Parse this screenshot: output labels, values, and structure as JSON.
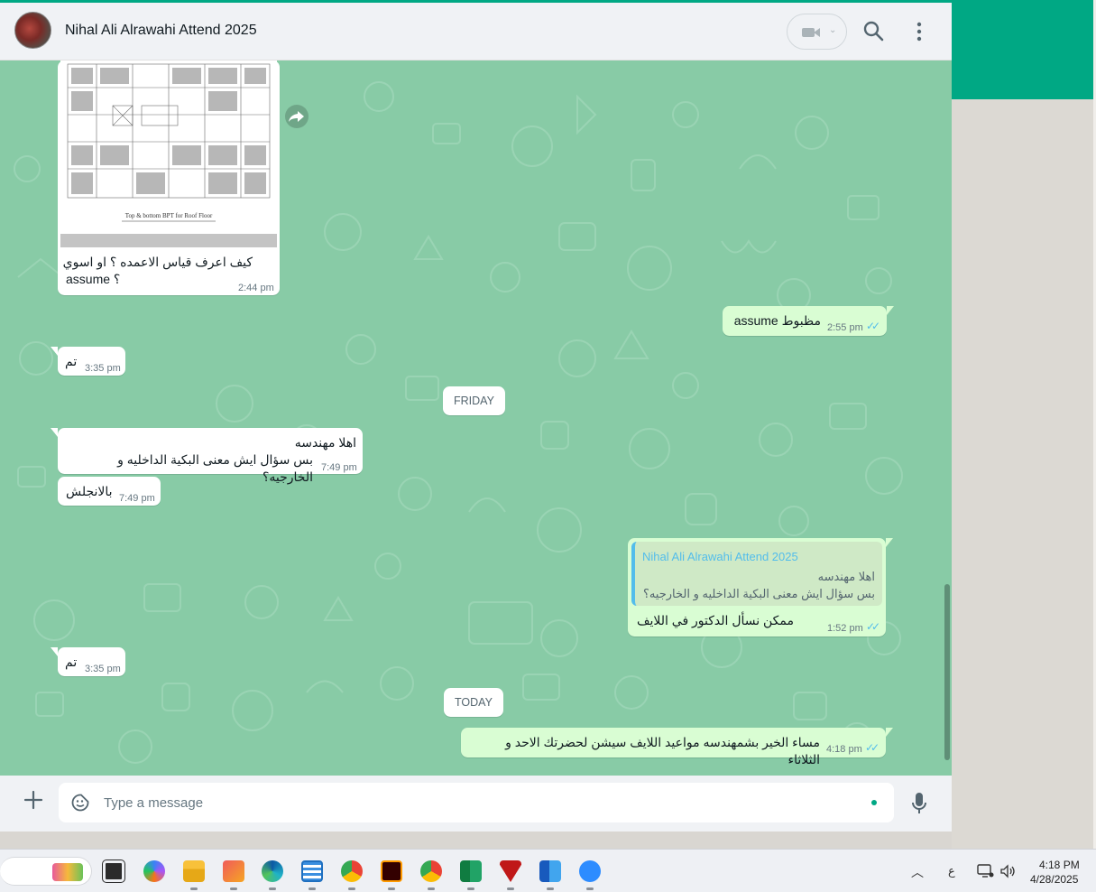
{
  "chat": {
    "title": "Nihal Ali Alrawahi Attend 2025"
  },
  "header": {
    "video_icon": "video-camera-icon",
    "search_icon": "search-icon",
    "menu_icon": "menu-vertical-icon"
  },
  "messages": {
    "image_caption_line1": "كيف اعرف قياس الاعمده ؟ او اسوي",
    "image_caption_line2": "assume ؟",
    "image_time": "2:44 pm",
    "image_plan_label": "Top & bottom BPT for Roof Floor",
    "m1_text": "assume  مظبوط",
    "m1_time": "2:55 pm",
    "m2_text": "تم",
    "m2_time": "3:35 pm",
    "day1": "FRIDAY",
    "m3_line1": "اهلا مهندسه",
    "m3_line2": "بس سؤال ايش معنى البكية الداخليه و الخارجيه؟",
    "m3_time": "7:49 pm",
    "m4_text": "بالانجلش",
    "m4_time": "7:49 pm",
    "m5_quote_author": "Nihal Ali Alrawahi Attend 2025",
    "m5_quote_line1": "اهلا مهندسه",
    "m5_quote_line2": "بس سؤال ايش معنى البكية الداخليه و الخارجيه؟",
    "m5_text": "ممكن نسأل الدكتور في اللايف",
    "m5_time": "1:52 pm",
    "m6_text": "تم",
    "m6_time": "3:35 pm",
    "day2": "TODAY",
    "m7_text": "مساء الخير بشمهندسه مواعيد اللايف سيشن  لحضرتك الاحد و الثلاثاء",
    "m7_time": "4:18 pm",
    "read_ticks": "✓✓"
  },
  "composer": {
    "placeholder": "Type a message"
  },
  "taskbar": {
    "lang": "ع",
    "time": "4:18 PM",
    "date": "4/28/2025"
  },
  "colors": {
    "accent": "#00a884",
    "chat_bg": "#88cba6",
    "incoming_bubble": "#ffffff",
    "outgoing_bubble": "#d9fdd3",
    "read_tick": "#53bdeb"
  }
}
